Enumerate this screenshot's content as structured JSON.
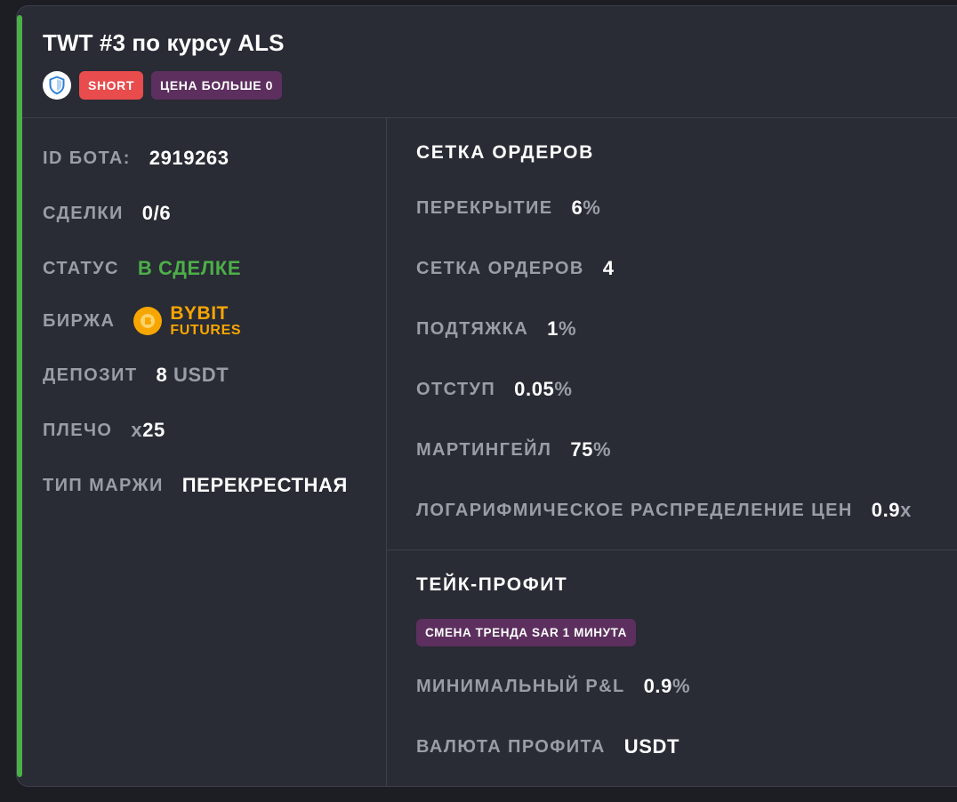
{
  "bot": {
    "title": "TWT #3 по курсу ALS",
    "direction_badge": "SHORT",
    "condition_badge": "ЦЕНА БОЛЬШЕ 0"
  },
  "colors": {
    "accent_green": "#4caf47",
    "short_red": "#e84c4c",
    "badge_purple": "#5c2f5e",
    "bybit_orange": "#f7a600",
    "card_bg": "#292b35"
  },
  "info": {
    "id_label": "ID БОТА:",
    "id_value": "2919263",
    "deals_label": "СДЕЛКИ",
    "deals_value": "0/6",
    "status_label": "СТАТУС",
    "status_value": "В СДЕЛКЕ",
    "exchange_label": "БИРЖА",
    "exchange_name": "BYBIT",
    "exchange_sub": "FUTURES",
    "deposit_label": "ДЕПОЗИТ",
    "deposit_value": "8",
    "deposit_unit": "USDT",
    "leverage_label": "ПЛЕЧО",
    "leverage_prefix": "x",
    "leverage_value": "25",
    "margin_label": "ТИП МАРЖИ",
    "margin_value": "ПЕРЕКРЕСТНАЯ"
  },
  "grid": {
    "title": "СЕТКА ОРДЕРОВ",
    "overlap_label": "ПЕРЕКРЫТИЕ",
    "overlap_value": "6",
    "orders_label": "СЕТКА ОРДЕРОВ",
    "orders_value": "4",
    "pullup_label": "ПОДТЯЖКА",
    "pullup_value": "1",
    "offset_label": "ОТСТУП",
    "offset_value": "0.05",
    "martingale_label": "МАРТИНГЕЙЛ",
    "martingale_value": "75",
    "log_label": "ЛОГАРИФМИЧЕСКОЕ РАСПРЕДЕЛЕНИЕ ЦЕН",
    "log_value": "0.9",
    "log_unit": "x",
    "percent": "%"
  },
  "takeprofit": {
    "title": "ТЕЙК-ПРОФИТ",
    "trend_badge": "СМЕНА ТРЕНДА SAR 1 МИНУТА",
    "min_pnl_label": "МИНИМАЛЬНЫЙ P&L",
    "min_pnl_value": "0.9",
    "currency_label": "ВАЛЮТА ПРОФИТА",
    "currency_value": "USDT"
  },
  "icons": {
    "shield": "shield-icon",
    "bybit": "bybit-logo-icon"
  }
}
